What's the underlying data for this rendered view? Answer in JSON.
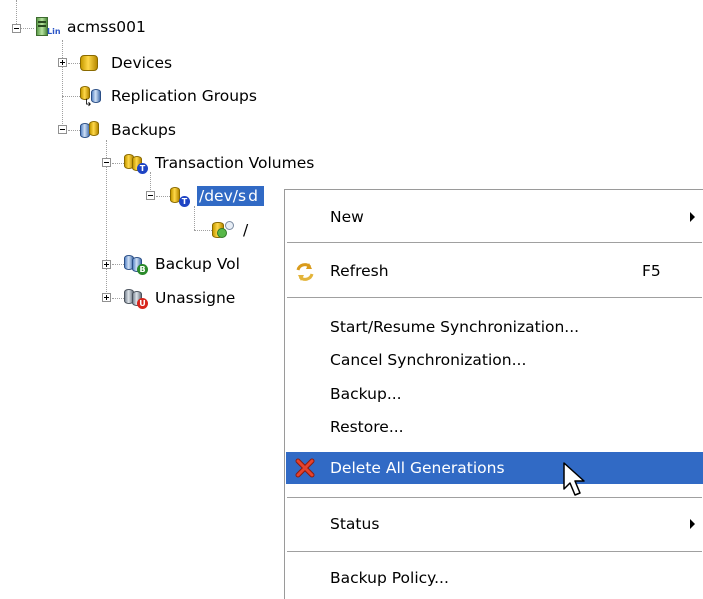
{
  "tree": {
    "root": {
      "label": "acmss001",
      "badge": "Lin"
    },
    "devices": {
      "label": "Devices"
    },
    "replication_groups": {
      "label": "Replication Groups"
    },
    "backups": {
      "label": "Backups"
    },
    "transaction_volumes": {
      "label": "Transaction Volumes",
      "badge": "T"
    },
    "selected_volume": {
      "label": "/dev/s",
      "badge": "T",
      "partial": "d"
    },
    "generation": {
      "label": "/"
    },
    "backup_volumes": {
      "label": "Backup Vol",
      "badge": "B"
    },
    "unassigned": {
      "label": "Unassigne",
      "badge": "U"
    }
  },
  "context_menu": {
    "new": {
      "label": "New"
    },
    "refresh": {
      "label": "Refresh",
      "shortcut": "F5"
    },
    "start_resume": {
      "label": "Start/Resume Synchronization..."
    },
    "cancel_sync": {
      "label": "Cancel Synchronization..."
    },
    "backup": {
      "label": "Backup..."
    },
    "restore": {
      "label": "Restore..."
    },
    "delete_all": {
      "label": "Delete All Generations"
    },
    "status": {
      "label": "Status"
    },
    "backup_policy": {
      "label": "Backup Policy..."
    }
  },
  "colors": {
    "selection": "#316ac5",
    "separator": "#a0a0a0"
  }
}
